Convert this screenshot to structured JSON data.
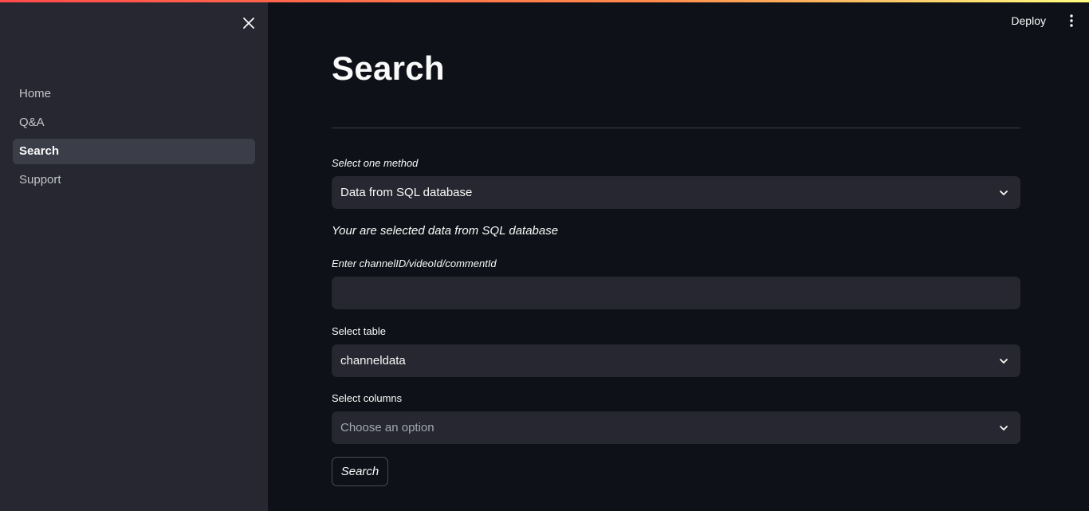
{
  "sidebar": {
    "items": [
      {
        "label": "Home"
      },
      {
        "label": "Q&A"
      },
      {
        "label": "Search"
      },
      {
        "label": "Support"
      }
    ]
  },
  "header": {
    "deploy_label": "Deploy"
  },
  "main": {
    "title": "Search",
    "method": {
      "label": "Select one method",
      "value": "Data from SQL database"
    },
    "info_text": "Your are selected data from SQL database",
    "id_input": {
      "label": "Enter channelID/videoId/commentId",
      "value": ""
    },
    "table": {
      "label": "Select table",
      "value": "channeldata"
    },
    "columns": {
      "label": "Select columns",
      "placeholder": "Choose an option"
    },
    "search_button": "Search"
  },
  "colors": {
    "background": "#0e1117",
    "sidebar": "#262730",
    "accent": "#ff4b4b"
  }
}
